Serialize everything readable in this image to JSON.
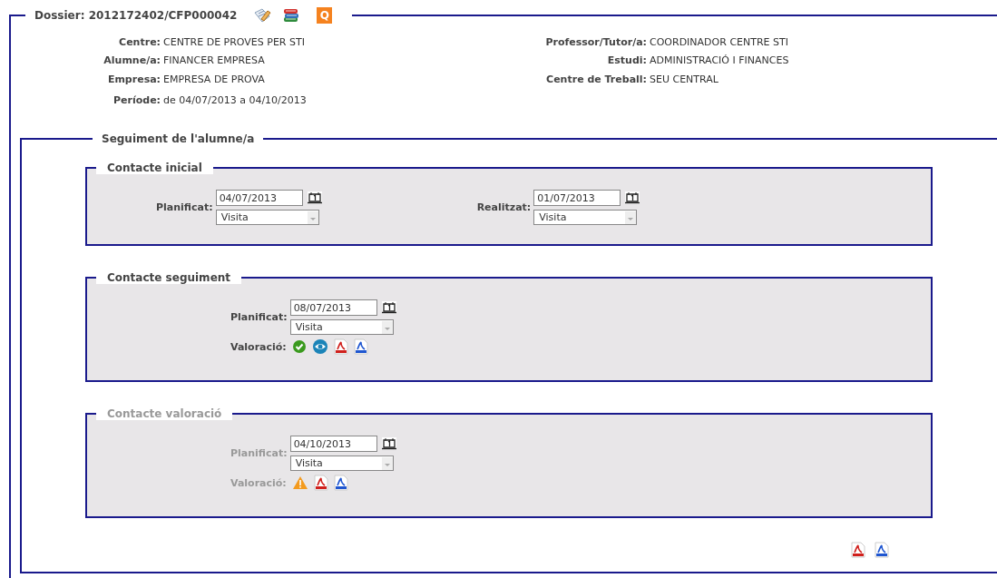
{
  "dossier": {
    "title": "Dossier: 2012172402/CFP000042",
    "tools": [
      {
        "kind": "edit"
      },
      {
        "kind": "books"
      },
      {
        "kind": "badge",
        "text": "Q"
      }
    ]
  },
  "info_left": [
    {
      "label": "Centre:",
      "value": "CENTRE DE PROVES PER STI"
    },
    {
      "label": "Alumne/a:",
      "value": "FINANCER EMPRESA"
    },
    {
      "label": "Empresa:",
      "value": "EMPRESA DE PROVA"
    },
    {
      "label": "Període:",
      "value": "de 04/07/2013 a 04/10/2013"
    }
  ],
  "info_right": [
    {
      "label": "Professor/Tutor/a:",
      "value": "COORDINADOR CENTRE STI"
    },
    {
      "label": "Estudi:",
      "value": "ADMINISTRACIÓ I FINANCES"
    },
    {
      "label": "Centre de Treball:",
      "value": "SEU CENTRAL"
    }
  ],
  "tracking": {
    "title": "Seguiment de l'alumne/a",
    "sections": [
      {
        "title": "Contacte inicial",
        "kind": "two",
        "disabled": false,
        "fields": [
          {
            "label": "Planificat:",
            "date": "04/07/2013",
            "type": "Visita"
          },
          {
            "label": "Realitzat:",
            "date": "01/07/2013",
            "type": "Visita"
          }
        ]
      },
      {
        "title": "Contacte seguiment",
        "kind": "single",
        "disabled": false,
        "fields": [
          {
            "label": "Planificat:",
            "date": "08/07/2013",
            "type": "Visita"
          }
        ],
        "assessment": {
          "label": "Valoració:",
          "icons": [
            {
              "kind": "check"
            },
            {
              "kind": "eye"
            },
            {
              "kind": "pdf-red"
            },
            {
              "kind": "pdf-blue"
            }
          ]
        }
      },
      {
        "title": "Contacte valoració",
        "kind": "single",
        "disabled": true,
        "fields": [
          {
            "label": "Planificat:",
            "date": "04/10/2013",
            "type": "Visita"
          }
        ],
        "assessment": {
          "label": "Valoració:",
          "icons": [
            {
              "kind": "warning"
            },
            {
              "kind": "pdf-red"
            },
            {
              "kind": "pdf-blue"
            }
          ]
        }
      }
    ],
    "footer_icons": [
      {
        "kind": "pdf-red"
      },
      {
        "kind": "pdf-blue"
      }
    ]
  }
}
